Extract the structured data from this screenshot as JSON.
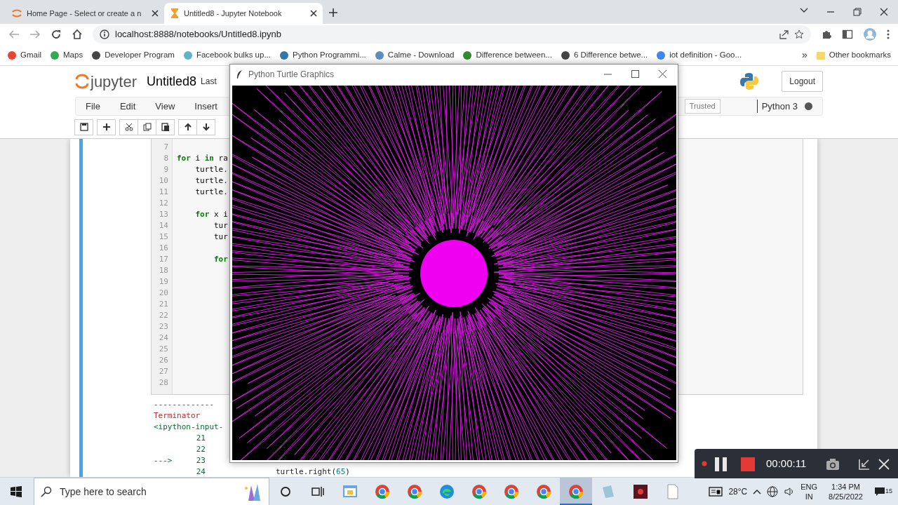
{
  "browser": {
    "tabs": [
      {
        "title": "Home Page - Select or create a n",
        "kind": "jupyter",
        "selected": false
      },
      {
        "title": "Untitled8 - Jupyter Notebook",
        "kind": "hourglass",
        "selected": true
      }
    ],
    "address": "localhost:8888/notebooks/Untitled8.ipynb",
    "bookmarks": [
      {
        "label": "Gmail",
        "color": "#ea4335"
      },
      {
        "label": "Maps",
        "color": "#34a853"
      },
      {
        "label": "Developer Program",
        "color": "#444444"
      },
      {
        "label": "Facebook bulks up...",
        "color": "#5fb3c9"
      },
      {
        "label": "Python Programmi...",
        "color": "#3776ab"
      },
      {
        "label": "Calme - Download",
        "color": "#5a8fc0"
      },
      {
        "label": "Difference between...",
        "color": "#2e8b2e"
      },
      {
        "label": "6 Difference betwe...",
        "color": "#444444"
      },
      {
        "label": "iot definition - Goo...",
        "color": "#4285f4"
      }
    ],
    "more_bookmarks": "»",
    "other_bookmarks": "Other bookmarks"
  },
  "jupyter": {
    "logo": "jupyter",
    "notebook_title": "Untitled8",
    "checkpoint": "Last",
    "logout": "Logout",
    "menu": [
      "File",
      "Edit",
      "View",
      "Insert"
    ],
    "trusted": "Trusted",
    "kernel": "Python 3",
    "kernel_busy": true
  },
  "code_cell": {
    "lines": [
      {
        "number": "7"
      },
      {
        "number": "8",
        "tokens": [
          {
            "text": "for",
            "kind": "keyword"
          },
          {
            "text": " i ",
            "kind": "plain"
          },
          {
            "text": "in",
            "kind": "keyword"
          },
          {
            "text": " ra",
            "kind": "plain"
          }
        ]
      },
      {
        "number": "9",
        "tokens": [
          {
            "text": "    turtle.",
            "kind": "plain"
          }
        ]
      },
      {
        "number": "10",
        "tokens": [
          {
            "text": "    turtle.",
            "kind": "plain"
          }
        ]
      },
      {
        "number": "11",
        "tokens": [
          {
            "text": "    turtle.",
            "kind": "plain"
          }
        ]
      },
      {
        "number": "12"
      },
      {
        "number": "13",
        "tokens": [
          {
            "text": "    for",
            "kind": "keyword"
          },
          {
            "text": " x i",
            "kind": "plain"
          }
        ]
      },
      {
        "number": "14",
        "tokens": [
          {
            "text": "        tur",
            "kind": "plain"
          }
        ]
      },
      {
        "number": "15",
        "tokens": [
          {
            "text": "        tur",
            "kind": "plain"
          }
        ]
      },
      {
        "number": "16"
      },
      {
        "number": "17",
        "tokens": [
          {
            "text": "        for",
            "kind": "keyword"
          }
        ]
      },
      {
        "number": "18"
      },
      {
        "number": "19"
      },
      {
        "number": "20"
      },
      {
        "number": "21"
      },
      {
        "number": "22"
      },
      {
        "number": "23"
      },
      {
        "number": "24"
      },
      {
        "number": "25"
      },
      {
        "number": "26"
      },
      {
        "number": "27"
      },
      {
        "number": "28"
      }
    ]
  },
  "output": {
    "rule": "-------------",
    "error_name": "Terminator",
    "location": "<ipython-input-",
    "traceback": [
      {
        "number": "21"
      },
      {
        "number": "22"
      },
      {
        "marker": "--->",
        "number": "23"
      },
      {
        "number": "24",
        "tokens": [
          {
            "text": "turtle.right(",
            "kind": "plain"
          },
          {
            "text": "65",
            "kind": "number"
          },
          {
            "text": ")",
            "kind": "plain"
          }
        ]
      }
    ]
  },
  "turtle_window": {
    "title": "Python Turtle Graphics"
  },
  "recorder": {
    "recording": true,
    "time": "00:00:11"
  },
  "taskbar": {
    "search_placeholder": "Type here to search",
    "apps": [
      {
        "kind": "window",
        "selected": false
      },
      {
        "kind": "chrome",
        "selected": false
      },
      {
        "kind": "chrome",
        "selected": false
      },
      {
        "kind": "edge",
        "selected": false
      },
      {
        "kind": "chrome",
        "selected": false
      },
      {
        "kind": "chrome",
        "selected": false
      },
      {
        "kind": "chrome",
        "selected": false
      },
      {
        "kind": "chrome",
        "selected": true
      },
      {
        "kind": "tile",
        "selected": false
      },
      {
        "kind": "recorder",
        "selected": false
      },
      {
        "kind": "document",
        "selected": false
      }
    ],
    "weather": "28°C",
    "language": "ENG",
    "region": "IN",
    "time": "1:34 PM",
    "date": "8/25/2022",
    "notifications": "15"
  }
}
